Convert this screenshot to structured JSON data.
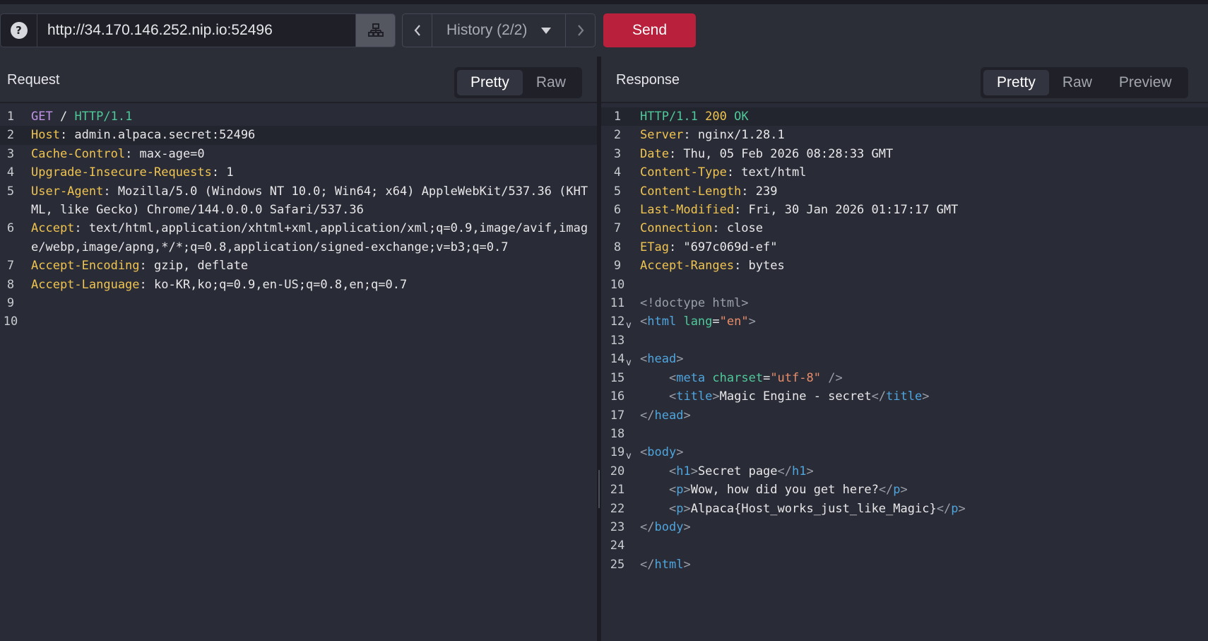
{
  "toolbar": {
    "url": "http://34.170.146.252.nip.io:52496",
    "history_label": "History (2/2)",
    "send_label": "Send",
    "help_glyph": "?"
  },
  "request": {
    "title": "Request",
    "tabs": [
      "Pretty",
      "Raw"
    ],
    "active_tab": "Pretty",
    "lines": [
      {
        "n": "1",
        "parts": [
          {
            "c": "k-method",
            "t": "GET"
          },
          {
            "c": "k-val",
            "t": " / "
          },
          {
            "c": "k-proto",
            "t": "HTTP/1.1"
          }
        ]
      },
      {
        "n": "2",
        "hl": true,
        "parts": [
          {
            "c": "k-key",
            "t": "Host"
          },
          {
            "c": "k-val",
            "t": ": admin.alpaca.secret:52496"
          }
        ]
      },
      {
        "n": "3",
        "parts": [
          {
            "c": "k-key",
            "t": "Cache-Control"
          },
          {
            "c": "k-val",
            "t": ": max-age=0"
          }
        ]
      },
      {
        "n": "4",
        "parts": [
          {
            "c": "k-key",
            "t": "Upgrade-Insecure-Requests"
          },
          {
            "c": "k-val",
            "t": ": 1"
          }
        ]
      },
      {
        "n": "5",
        "parts": [
          {
            "c": "k-key",
            "t": "User-Agent"
          },
          {
            "c": "k-val",
            "t": ": Mozilla/5.0 (Windows NT 10.0; Win64; x64) AppleWebKit/537.36 (KHTML, like Gecko) Chrome/144.0.0.0 Safari/537.36"
          }
        ]
      },
      {
        "n": "6",
        "parts": [
          {
            "c": "k-key",
            "t": "Accept"
          },
          {
            "c": "k-val",
            "t": ": text/html,application/xhtml+xml,application/xml;q=0.9,image/avif,image/webp,image/apng,*/*;q=0.8,application/signed-exchange;v=b3;q=0.7"
          }
        ]
      },
      {
        "n": "7",
        "parts": [
          {
            "c": "k-key",
            "t": "Accept-Encoding"
          },
          {
            "c": "k-val",
            "t": ": gzip, deflate"
          }
        ]
      },
      {
        "n": "8",
        "parts": [
          {
            "c": "k-key",
            "t": "Accept-Language"
          },
          {
            "c": "k-val",
            "t": ": ko-KR,ko;q=0.9,en-US;q=0.8,en;q=0.7"
          }
        ]
      },
      {
        "n": "9",
        "parts": []
      },
      {
        "n": "10",
        "parts": []
      }
    ]
  },
  "response": {
    "title": "Response",
    "tabs": [
      "Pretty",
      "Raw",
      "Preview"
    ],
    "active_tab": "Pretty",
    "lines": [
      {
        "n": "1",
        "hl": true,
        "parts": [
          {
            "c": "k-proto",
            "t": "HTTP/1.1"
          },
          {
            "c": "k-val",
            "t": " "
          },
          {
            "c": "k-status",
            "t": "200"
          },
          {
            "c": "k-val",
            "t": " "
          },
          {
            "c": "k-proto",
            "t": "OK"
          }
        ]
      },
      {
        "n": "2",
        "parts": [
          {
            "c": "k-key",
            "t": "Server"
          },
          {
            "c": "k-val",
            "t": ": nginx/1.28.1"
          }
        ]
      },
      {
        "n": "3",
        "parts": [
          {
            "c": "k-key",
            "t": "Date"
          },
          {
            "c": "k-val",
            "t": ": Thu, 05 Feb 2026 08:28:33 GMT"
          }
        ]
      },
      {
        "n": "4",
        "parts": [
          {
            "c": "k-key",
            "t": "Content-Type"
          },
          {
            "c": "k-val",
            "t": ": text/html"
          }
        ]
      },
      {
        "n": "5",
        "parts": [
          {
            "c": "k-key",
            "t": "Content-Length"
          },
          {
            "c": "k-val",
            "t": ": 239"
          }
        ]
      },
      {
        "n": "6",
        "parts": [
          {
            "c": "k-key",
            "t": "Last-Modified"
          },
          {
            "c": "k-val",
            "t": ": Fri, 30 Jan 2026 01:17:17 GMT"
          }
        ]
      },
      {
        "n": "7",
        "parts": [
          {
            "c": "k-key",
            "t": "Connection"
          },
          {
            "c": "k-val",
            "t": ": close"
          }
        ]
      },
      {
        "n": "8",
        "parts": [
          {
            "c": "k-key",
            "t": "ETag"
          },
          {
            "c": "k-val",
            "t": ": \"697c069d-ef\""
          }
        ]
      },
      {
        "n": "9",
        "parts": [
          {
            "c": "k-key",
            "t": "Accept-Ranges"
          },
          {
            "c": "k-val",
            "t": ": bytes"
          }
        ]
      },
      {
        "n": "10",
        "parts": []
      },
      {
        "n": "11",
        "parts": [
          {
            "c": "k-punct",
            "t": "<!doctype html>"
          }
        ]
      },
      {
        "n": "12",
        "fold": true,
        "parts": [
          {
            "c": "k-punct",
            "t": "<"
          },
          {
            "c": "k-tag",
            "t": "html"
          },
          {
            "c": "k-val",
            "t": " "
          },
          {
            "c": "k-attr",
            "t": "lang"
          },
          {
            "c": "k-val",
            "t": "="
          },
          {
            "c": "k-str",
            "t": "\"en\""
          },
          {
            "c": "k-punct",
            "t": ">"
          }
        ]
      },
      {
        "n": "13",
        "parts": []
      },
      {
        "n": "14",
        "fold": true,
        "parts": [
          {
            "c": "k-punct",
            "t": "<"
          },
          {
            "c": "k-tag",
            "t": "head"
          },
          {
            "c": "k-punct",
            "t": ">"
          }
        ]
      },
      {
        "n": "15",
        "parts": [
          {
            "c": "k-val",
            "t": "    "
          },
          {
            "c": "k-punct",
            "t": "<"
          },
          {
            "c": "k-tag",
            "t": "meta"
          },
          {
            "c": "k-val",
            "t": " "
          },
          {
            "c": "k-attr",
            "t": "charset"
          },
          {
            "c": "k-val",
            "t": "="
          },
          {
            "c": "k-str",
            "t": "\"utf-8\""
          },
          {
            "c": "k-val",
            "t": " "
          },
          {
            "c": "k-punct",
            "t": "/>"
          }
        ]
      },
      {
        "n": "16",
        "parts": [
          {
            "c": "k-val",
            "t": "    "
          },
          {
            "c": "k-punct",
            "t": "<"
          },
          {
            "c": "k-tag",
            "t": "title"
          },
          {
            "c": "k-punct",
            "t": ">"
          },
          {
            "c": "k-val",
            "t": "Magic Engine - secret"
          },
          {
            "c": "k-punct",
            "t": "</"
          },
          {
            "c": "k-tag",
            "t": "title"
          },
          {
            "c": "k-punct",
            "t": ">"
          }
        ]
      },
      {
        "n": "17",
        "parts": [
          {
            "c": "k-punct",
            "t": "</"
          },
          {
            "c": "k-tag",
            "t": "head"
          },
          {
            "c": "k-punct",
            "t": ">"
          }
        ]
      },
      {
        "n": "18",
        "parts": []
      },
      {
        "n": "19",
        "fold": true,
        "parts": [
          {
            "c": "k-punct",
            "t": "<"
          },
          {
            "c": "k-tag",
            "t": "body"
          },
          {
            "c": "k-punct",
            "t": ">"
          }
        ]
      },
      {
        "n": "20",
        "parts": [
          {
            "c": "k-val",
            "t": "    "
          },
          {
            "c": "k-punct",
            "t": "<"
          },
          {
            "c": "k-tag",
            "t": "h1"
          },
          {
            "c": "k-punct",
            "t": ">"
          },
          {
            "c": "k-val",
            "t": "Secret page"
          },
          {
            "c": "k-punct",
            "t": "</"
          },
          {
            "c": "k-tag",
            "t": "h1"
          },
          {
            "c": "k-punct",
            "t": ">"
          }
        ]
      },
      {
        "n": "21",
        "parts": [
          {
            "c": "k-val",
            "t": "    "
          },
          {
            "c": "k-punct",
            "t": "<"
          },
          {
            "c": "k-tag",
            "t": "p"
          },
          {
            "c": "k-punct",
            "t": ">"
          },
          {
            "c": "k-val",
            "t": "Wow, how did you get here?"
          },
          {
            "c": "k-punct",
            "t": "</"
          },
          {
            "c": "k-tag",
            "t": "p"
          },
          {
            "c": "k-punct",
            "t": ">"
          }
        ]
      },
      {
        "n": "22",
        "parts": [
          {
            "c": "k-val",
            "t": "    "
          },
          {
            "c": "k-punct",
            "t": "<"
          },
          {
            "c": "k-tag",
            "t": "p"
          },
          {
            "c": "k-punct",
            "t": ">"
          },
          {
            "c": "k-val",
            "t": "Alpaca{Host_works_just_like_Magic}"
          },
          {
            "c": "k-punct",
            "t": "</"
          },
          {
            "c": "k-tag",
            "t": "p"
          },
          {
            "c": "k-punct",
            "t": ">"
          }
        ]
      },
      {
        "n": "23",
        "parts": [
          {
            "c": "k-punct",
            "t": "</"
          },
          {
            "c": "k-tag",
            "t": "body"
          },
          {
            "c": "k-punct",
            "t": ">"
          }
        ]
      },
      {
        "n": "24",
        "parts": []
      },
      {
        "n": "25",
        "parts": [
          {
            "c": "k-punct",
            "t": "</"
          },
          {
            "c": "k-tag",
            "t": "html"
          },
          {
            "c": "k-punct",
            "t": ">"
          }
        ]
      }
    ]
  },
  "icons": {
    "help": "help-circle-icon",
    "site_map": "site-map-icon",
    "prev": "chevron-left-icon",
    "next": "chevron-right-icon",
    "dropdown": "caret-down-icon",
    "fold": "fold-chevron-icon"
  },
  "colors": {
    "send": "#b8203b",
    "header_key": "#f0c450",
    "protocol": "#4fc99a",
    "method": "#c294e8",
    "tag": "#4fa5dd",
    "string": "#e88d6a"
  }
}
